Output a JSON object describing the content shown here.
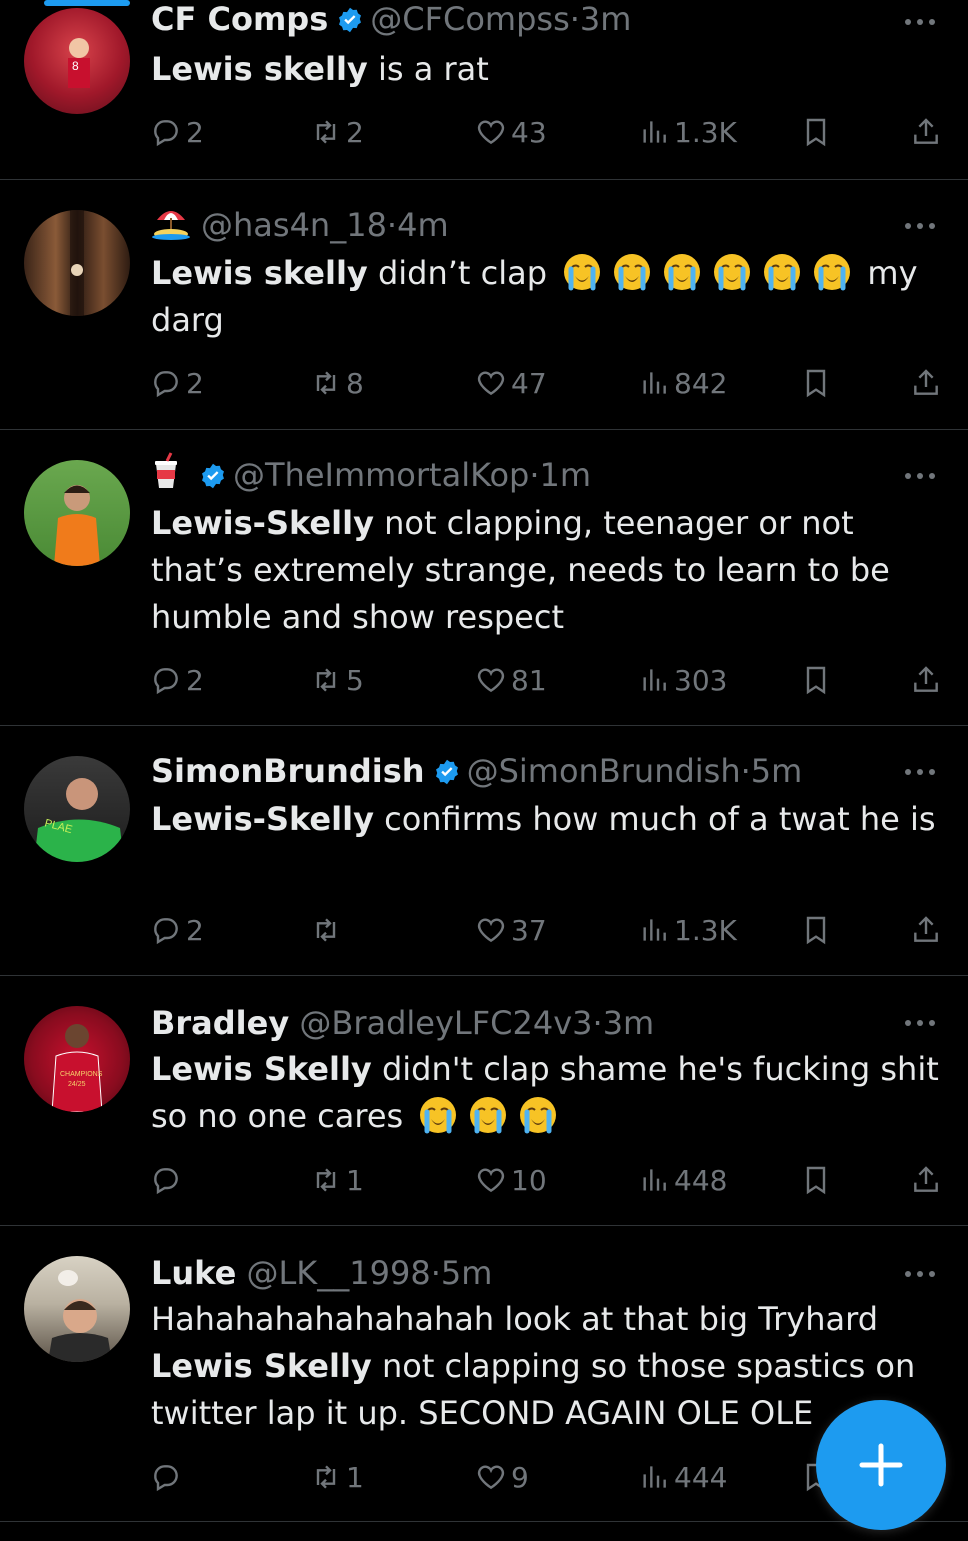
{
  "tweets": [
    {
      "name": "CF Comps",
      "verified": true,
      "handle": "@CFCompss",
      "time": "3m",
      "text_bold": "Lewis skelly",
      "text": " is a rat",
      "replies": "2",
      "reposts": "2",
      "likes": "43",
      "views": "1.3K"
    },
    {
      "name_emoji": "beach-umbrella",
      "handle": "@has4n_18",
      "time": "4m",
      "text_bold": "Lewis skelly",
      "text": " didn’t clap ",
      "cry_count": 6,
      "text_after": " my darg",
      "replies": "2",
      "reposts": "8",
      "likes": "47",
      "views": "842"
    },
    {
      "name_emoji": "cup-with-straw",
      "verified": true,
      "handle": "@TheImmortalKop",
      "time": "1m",
      "text_bold": "Lewis-Skelly",
      "text": " not clapping, teenager or not that’s extremely strange, needs to learn to be humble and show respect",
      "replies": "2",
      "reposts": "5",
      "likes": "81",
      "views": "303"
    },
    {
      "name": "SimonBrundish",
      "verified": true,
      "handle": "@SimonBrundish",
      "time": "5m",
      "text_bold": "Lewis-Skelly",
      "text": " confirms how much of a twat he is",
      "replies": "2",
      "reposts": "",
      "likes": "37",
      "views": "1.3K"
    },
    {
      "name": "Bradley",
      "handle": "@BradleyLFC24v3",
      "time": "3m",
      "text_bold": "Lewis Skelly",
      "text": " didn't clap shame he's fucking shit so no one cares ",
      "cry_count": 3,
      "text_after": "",
      "replies": "",
      "reposts": "1",
      "likes": "10",
      "views": "448"
    },
    {
      "name": "Luke",
      "handle": "@LK__1998",
      "time": "5m",
      "text_pre": "Hahahahahahahahah look at that big Tryhard ",
      "text_bold": "Lewis Skelly",
      "text": " not clapping so those spastics on twitter lap it up. SECOND AGAIN OLE OLE",
      "replies": "",
      "reposts": "1",
      "likes": "9",
      "views": "444"
    }
  ],
  "fab": {
    "icon": "plus-icon"
  },
  "colors": {
    "accent": "#1d9bf0",
    "muted": "#71767b",
    "text": "#e7e9ea",
    "divider": "#2f3336"
  }
}
